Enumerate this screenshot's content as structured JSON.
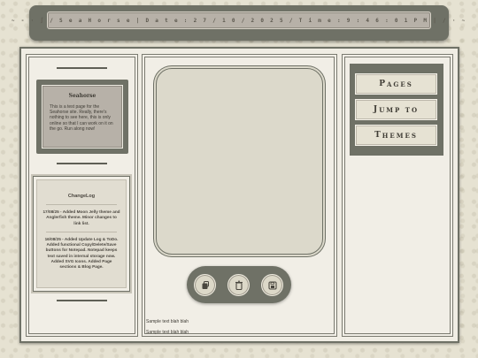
{
  "header": {
    "status_text": "~ - · ∫ / S e a  H o r s e  |  D a t e :  2 7 / 1 0 / 2 0 2 5  /  T i m e :  9 : 4 6 : 0 1  P M  | /  · ~"
  },
  "sidebar": {
    "seahorse_card": {
      "title": "Seahorse",
      "body": "This is a test page for the Seahorse site. Really, there's nothing to see here, this is only online so that I can work on it on the go. Run along now!"
    },
    "changelog": {
      "title": "ChangeLog",
      "entries": [
        "17/08/25 - Added Moon Jelly theme and Anglerfish theme. Minor changes to link list.",
        "16/08/25 - Added Update Log & ToDo. Added functional Copy/Delete/Save buttons for Notepad. Notepad keeps text saved in internal storage now. Added SVG Icons. Added Page sections & Blog Page."
      ]
    }
  },
  "center": {
    "sample_lines": [
      "Sample text blah blah",
      "Sample text blah blah"
    ],
    "buttons": {
      "copy": "copy-icon",
      "delete": "trash-icon",
      "save": "save-icon"
    }
  },
  "nav": {
    "pages": {
      "cap": "P",
      "rest": "AGES"
    },
    "jump_to": {
      "cap": "J",
      "rest": "UMP TO"
    },
    "themes": {
      "cap": "T",
      "rest": "HEMES"
    }
  },
  "colors": {
    "frame": "#6f7166",
    "card": "#b7b1a8",
    "paper": "#f1eee6",
    "screen": "#dcd9cb"
  }
}
